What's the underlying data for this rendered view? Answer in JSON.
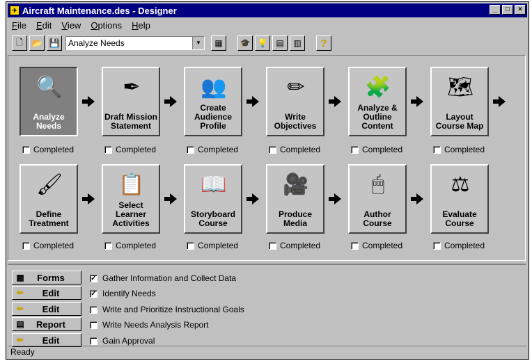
{
  "window": {
    "title": "Aircraft Maintenance.des - Designer"
  },
  "menu": [
    "File",
    "Edit",
    "View",
    "Options",
    "Help"
  ],
  "toolbar": {
    "selected_step": "Analyze Needs",
    "help_glyph": "?"
  },
  "steps": [
    {
      "label": "Analyze Needs",
      "icon": "magnifier-icon",
      "glyph": "🔍",
      "checkbox": "Completed",
      "active": true
    },
    {
      "label": "Draft Mission Statement",
      "icon": "pen-paper-icon",
      "glyph": "✒",
      "checkbox": "Completed"
    },
    {
      "label": "Create Audience Profile",
      "icon": "people-icon",
      "glyph": "👥",
      "checkbox": "Completed"
    },
    {
      "label": "Write Objectives",
      "icon": "pencil-icon",
      "glyph": "✏",
      "checkbox": "Completed"
    },
    {
      "label": "Analyze & Outline Content",
      "icon": "puzzle-icon",
      "glyph": "🧩",
      "checkbox": "Completed"
    },
    {
      "label": "Layout Course Map",
      "icon": "map-icon",
      "glyph": "🗺",
      "checkbox": "Completed"
    },
    {
      "label": "Define Treatment",
      "icon": "paintbrush-icon",
      "glyph": "🖌",
      "checkbox": "Completed"
    },
    {
      "label": "Select Learner Activities",
      "icon": "chalkboard-icon",
      "glyph": "📋",
      "checkbox": "Completed"
    },
    {
      "label": "Storyboard Course",
      "icon": "book-icon",
      "glyph": "📖",
      "checkbox": "Completed"
    },
    {
      "label": "Produce Media",
      "icon": "camera-icon",
      "glyph": "🎥",
      "checkbox": "Completed"
    },
    {
      "label": "Author Course",
      "icon": "mouse-hand-icon",
      "glyph": "🖱",
      "checkbox": "Completed"
    },
    {
      "label": "Evaluate Course",
      "icon": "scale-icon",
      "glyph": "⚖",
      "checkbox": "Completed"
    }
  ],
  "actions": [
    {
      "label": "Forms",
      "icon": "forms-icon",
      "glyph": "▦"
    },
    {
      "label": "Edit",
      "icon": "pencil-icon",
      "glyph": "✏"
    },
    {
      "label": "Edit",
      "icon": "pencil-icon",
      "glyph": "✏"
    },
    {
      "label": "Report",
      "icon": "report-icon",
      "glyph": "▤"
    },
    {
      "label": "Edit",
      "icon": "pencil-icon",
      "glyph": "✏"
    }
  ],
  "tasks": [
    {
      "label": "Gather Information and Collect Data",
      "checked": true
    },
    {
      "label": "Identify Needs",
      "checked": true
    },
    {
      "label": "Write and Prioritize Instructional Goals",
      "checked": false
    },
    {
      "label": "Write Needs Analysis Report",
      "checked": false
    },
    {
      "label": "Gain Approval",
      "checked": false
    }
  ],
  "status": "Ready"
}
